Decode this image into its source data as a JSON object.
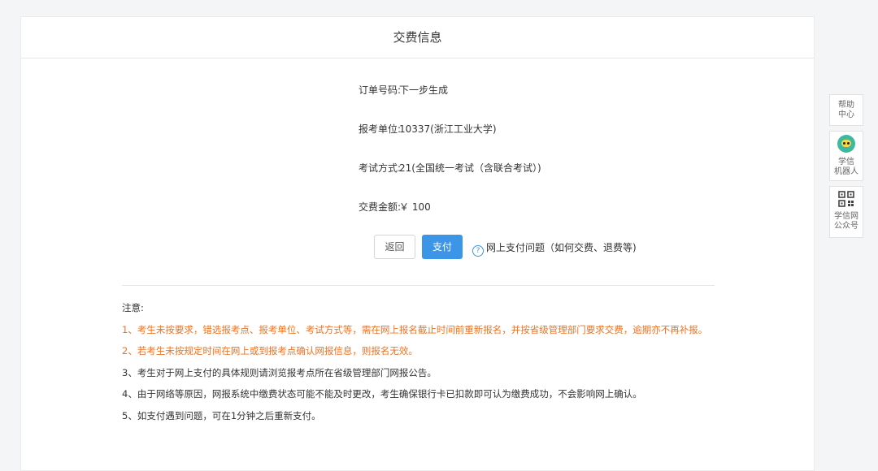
{
  "header": {
    "title": "交费信息"
  },
  "info": [
    {
      "label": "订单号码:",
      "value": "下一步生成"
    },
    {
      "label": "报考单位:",
      "value": "10337(浙江工业大学)"
    },
    {
      "label": "考试方式:",
      "value": "21(全国统一考试（含联合考试）)"
    },
    {
      "label": "交费金额:",
      "value": "￥ 100"
    }
  ],
  "actions": {
    "back_label": "返回",
    "pay_label": "支付",
    "help_label": "网上支付问题（如何交费、退费等)"
  },
  "notes": {
    "title": "注意:",
    "items": [
      "1、考生未按要求，错选报考点、报考单位、考试方式等，需在网上报名截止时间前重新报名，并按省级管理部门要求交费，逾期亦不再补报。",
      "2、若考生未按规定时间在网上或到报考点确认网报信息，则报名无效。",
      "3、考生对于网上支付的具体规则请浏览报考点所在省级管理部门网报公告。",
      "4、由于网络等原因，网报系统中缴费状态可能不能及时更改，考生确保银行卡已扣款即可认为缴费成功，不会影响网上确认。",
      "5、如支付遇到问题，可在1分钟之后重新支付。"
    ]
  },
  "sidebar": {
    "help_line1": "帮助",
    "help_line2": "中心",
    "robot_line1": "学信",
    "robot_line2": "机器人",
    "qr_line1": "学信网",
    "qr_line2": "公众号"
  },
  "colors": {
    "accent": "#3d95e8",
    "warning": "#ec7323"
  }
}
